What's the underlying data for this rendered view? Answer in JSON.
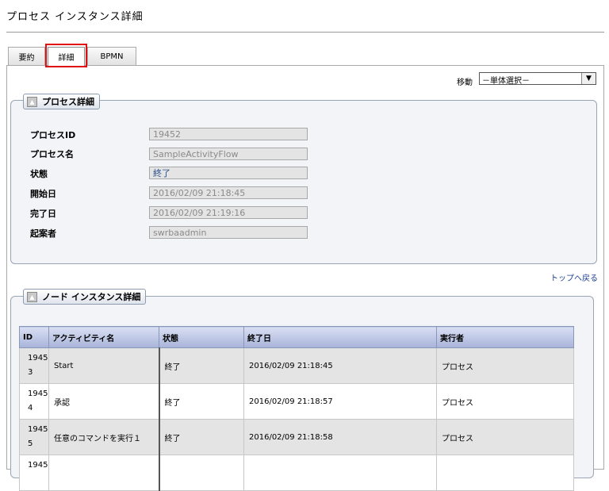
{
  "page": {
    "title": "プロセス インスタンス詳細"
  },
  "tabs": [
    {
      "label": "要約",
      "active": false
    },
    {
      "label": "詳細",
      "active": true
    },
    {
      "label": "BPMN",
      "active": false
    }
  ],
  "nav": {
    "label": "移動",
    "select_value": "－単体選択－"
  },
  "process_detail": {
    "legend": "プロセス詳細",
    "fields": [
      {
        "label": "プロセスID",
        "value": "19452"
      },
      {
        "label": "プロセス名",
        "value": "SampleActivityFlow"
      },
      {
        "label": "状態",
        "value": "終了"
      },
      {
        "label": "開始日",
        "value": "2016/02/09 21:18:45"
      },
      {
        "label": "完了日",
        "value": "2016/02/09 21:19:16"
      },
      {
        "label": "起案者",
        "value": "swrbaadmin"
      }
    ]
  },
  "top_link": "トップへ戻る",
  "node_detail": {
    "legend": "ノード インスタンス詳細",
    "columns": [
      "ID",
      "アクティビティ名",
      "状態",
      "終了日",
      "実行者"
    ],
    "rows": [
      {
        "id_1": "1945",
        "id_2": "3",
        "activity": "Start",
        "status": "終了",
        "end": "2016/02/09 21:18:45",
        "executor": "プロセス"
      },
      {
        "id_1": "1945",
        "id_2": "4",
        "activity": "承認",
        "status": "終了",
        "end": "2016/02/09 21:18:57",
        "executor": "プロセス"
      },
      {
        "id_1": "1945",
        "id_2": "5",
        "activity": "任意のコマンドを実行１",
        "status": "終了",
        "end": "2016/02/09 21:18:58",
        "executor": "プロセス"
      },
      {
        "id_1": "1945"
      }
    ]
  }
}
